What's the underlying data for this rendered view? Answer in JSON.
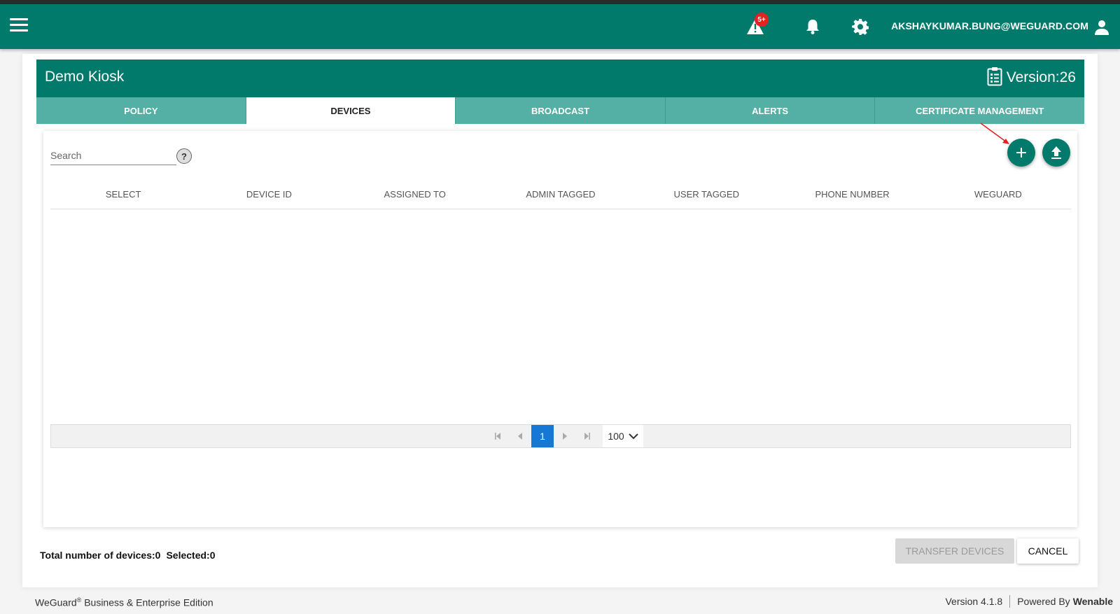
{
  "topbar": {
    "alerts_badge": "5+",
    "user_email": "AKSHAYKUMAR.BUNG@WEGUARD.COM",
    "icons": [
      "menu-icon",
      "alert-triangle-icon",
      "bell-icon",
      "gear-icon",
      "account-icon"
    ],
    "brand_color": "#01796b"
  },
  "policy": {
    "title": "Demo Kiosk",
    "version": "Version:26"
  },
  "tabs": [
    {
      "label": "POLICY",
      "active": false
    },
    {
      "label": "DEVICES",
      "active": true
    },
    {
      "label": "BROADCAST",
      "active": false
    },
    {
      "label": "ALERTS",
      "active": false
    },
    {
      "label": "CERTIFICATE MANAGEMENT",
      "active": false
    }
  ],
  "search": {
    "placeholder": "Search",
    "value": "",
    "help": "?"
  },
  "table": {
    "columns": [
      "SELECT",
      "DEVICE ID",
      "ASSIGNED TO",
      "ADMIN TAGGED",
      "USER TAGGED",
      "PHONE NUMBER",
      "WEGUARD"
    ],
    "rows": []
  },
  "pagination": {
    "current_page": "1",
    "page_size": "100"
  },
  "summary": {
    "total": "Total number of devices:0",
    "selected": "Selected:0"
  },
  "actions": {
    "transfer": "TRANSFER DEVICES",
    "cancel": "CANCEL"
  },
  "footer": {
    "product": "WeGuard",
    "reg": "®",
    "edition": " Business & Enterprise Edition",
    "version": "Version 4.1.8",
    "powered_by": "Powered By",
    "brand": "Wenable"
  }
}
